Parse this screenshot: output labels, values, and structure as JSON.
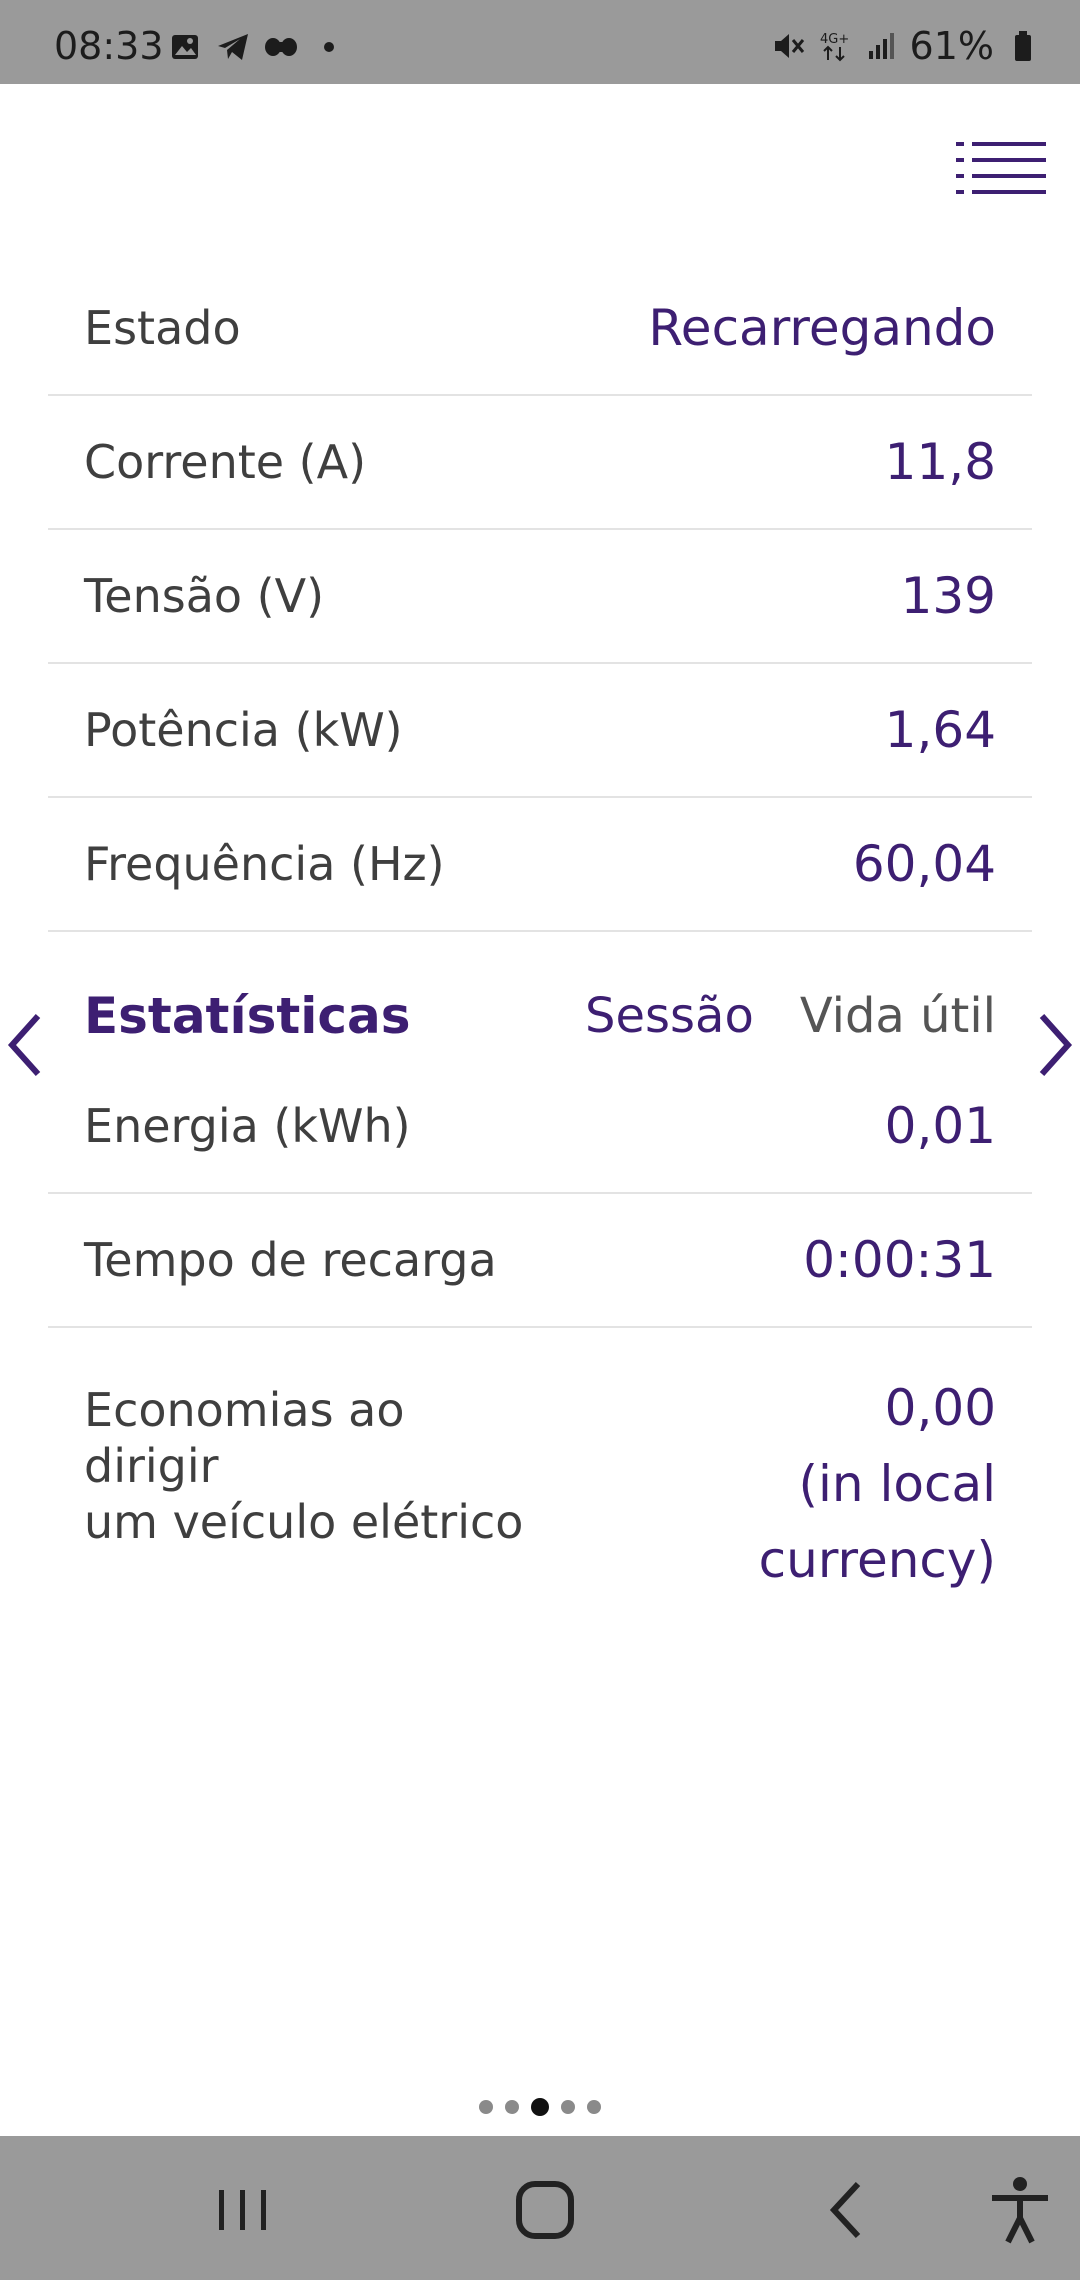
{
  "status_bar": {
    "time": "08:33",
    "battery": "61%",
    "left_icons": [
      "gallery-icon",
      "telegram-icon",
      "app-icon",
      "dot-icon"
    ],
    "right_icons": [
      "mute-icon",
      "4g-icon",
      "signal-icon",
      "battery-icon"
    ]
  },
  "header": {
    "menu_icon": "list-menu-icon"
  },
  "info_rows": [
    {
      "label": "Estado",
      "value": "Recarregando"
    },
    {
      "label": "Corrente (A)",
      "value": "11,8"
    },
    {
      "label": "Tensão (V)",
      "value": "139"
    },
    {
      "label": "Potência (kW)",
      "value": "1,64"
    },
    {
      "label": "Frequência (Hz)",
      "value": "60,04"
    }
  ],
  "stats": {
    "title": "Estatísticas",
    "tabs": [
      {
        "label": "Sessão",
        "active": true
      },
      {
        "label": "Vida útil",
        "active": false
      }
    ],
    "rows": [
      {
        "label": "Energia (kWh)",
        "value": "0,01"
      },
      {
        "label": "Tempo de recarga",
        "value": "0:00:31"
      }
    ],
    "savings": {
      "label_line1": "Economias ao dirigir",
      "label_line2": "um veículo elétrico",
      "value": "0,00",
      "unit": "(in local currency)"
    }
  },
  "pager": {
    "count": 5,
    "active_index": 2
  },
  "colors": {
    "accent": "#3d1f72",
    "status_bar": "#9a9a9a",
    "divider": "#e3e3e3"
  }
}
